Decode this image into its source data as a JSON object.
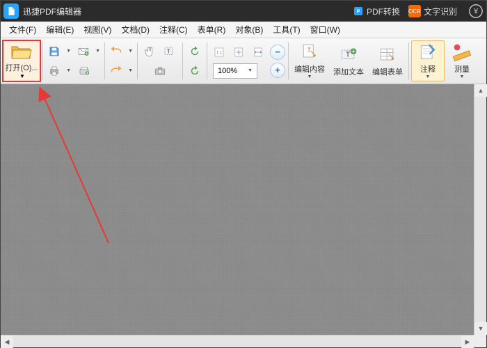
{
  "title": "迅捷PDF编辑器",
  "title_actions": {
    "pdf_convert": "PDF转换",
    "ocr": "文字识别"
  },
  "menu": {
    "file": "文件(F)",
    "edit": "编辑(E)",
    "view": "视图(V)",
    "document": "文档(D)",
    "comments": "注释(C)",
    "forms": "表单(R)",
    "objects": "对象(B)",
    "tools": "工具(T)",
    "window": "窗口(W)"
  },
  "toolbar": {
    "open": "打开(O)...",
    "zoom_value": "100%",
    "edit_content": "编辑内容",
    "add_text": "添加文本",
    "edit_forms": "编辑表单",
    "annotate": "注释",
    "measure": "测量"
  }
}
